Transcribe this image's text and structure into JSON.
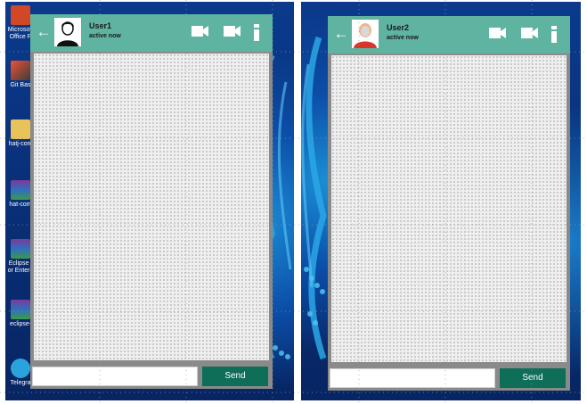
{
  "desktop": {
    "icons": [
      {
        "label": "Microsoft Office P",
        "icon": "office-icon",
        "color": "#d24726"
      },
      {
        "label": "Git Bas",
        "icon": "git-bash-icon",
        "color": "#3c3c3c"
      },
      {
        "label": "hatj-com",
        "icon": "folder-icon",
        "color": "#e8c35a"
      },
      {
        "label": "hat-com",
        "icon": "winrar-icon",
        "color": "#7b3a9a"
      },
      {
        "label": "Eclipse I or Enterp",
        "icon": "winrar-icon",
        "color": "#7b3a9a"
      },
      {
        "label": "eclipse-",
        "icon": "winrar-icon",
        "color": "#7b3a9a"
      },
      {
        "label": "Telegra",
        "icon": "telegram-icon",
        "color": "#2aa3dc"
      }
    ]
  },
  "chats": [
    {
      "user_name": "User1",
      "status": "active now",
      "back_icon": "back-arrow-icon",
      "avatar_icon": "user-avatar-icon",
      "header_icons": [
        "video-call-icon",
        "video-call-icon",
        "more-options-icon"
      ],
      "input_value": "",
      "send_label": "Send"
    },
    {
      "user_name": "User2",
      "status": "active now",
      "back_icon": "back-arrow-icon",
      "avatar_icon": "user-avatar-icon",
      "header_icons": [
        "video-call-icon",
        "video-call-icon",
        "more-options-icon"
      ],
      "input_value": "",
      "send_label": "Send"
    }
  ],
  "colors": {
    "header": "#5fb3a1",
    "send_button": "#0e6e57",
    "message_area": "#efefef",
    "frame": "#8a8a8a"
  }
}
